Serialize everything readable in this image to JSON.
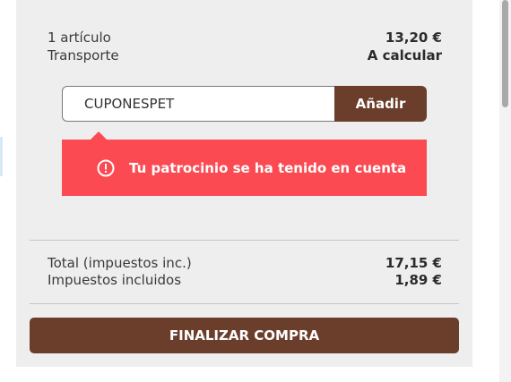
{
  "summary": {
    "items_label": "1 artículo",
    "items_value": "13,20 €",
    "shipping_label": "Transporte",
    "shipping_value": "A calcular"
  },
  "coupon": {
    "input_value": "CUPONESPET",
    "apply_label": "Añadir"
  },
  "alert": {
    "message": "Tu patrocinio se ha tenido en cuenta",
    "icon": "exclamation-circle-icon",
    "color": "#fb4a52"
  },
  "totals": {
    "total_label": "Total (impuestos inc.)",
    "total_value": "17,15 €",
    "taxes_label": "Impuestos incluidos",
    "taxes_value": "1,89 €"
  },
  "checkout": {
    "label": "FINALIZAR COMPRA"
  },
  "colors": {
    "brand": "#6b3d2b",
    "panel_bg": "#eeeeee"
  }
}
